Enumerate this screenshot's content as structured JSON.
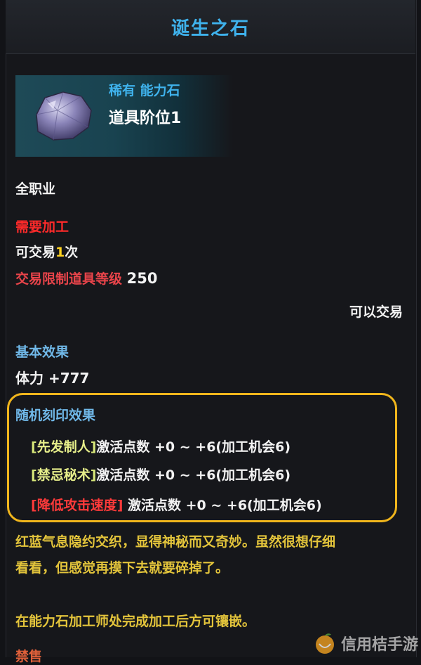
{
  "title": "诞生之石",
  "item": {
    "rarity": "稀有 能力石",
    "tier": "道具阶位1"
  },
  "job": "全职业",
  "requires_processing": "需要加工",
  "tradable": {
    "prefix": "可交易",
    "count": "1",
    "suffix": "次"
  },
  "trade_limit": {
    "label": "交易限制道具等级",
    "value": "250"
  },
  "can_trade": "可以交易",
  "basic_effect": {
    "header": "基本效果",
    "stat": "体力 +777"
  },
  "random_engrave": {
    "header": "随机刻印效果",
    "effects": [
      {
        "open": "[",
        "name": "先发制人",
        "close": "]",
        "text": "激活点数 +0 ~ +6(加工机会6)"
      },
      {
        "open": "[",
        "name": "禁忌秘术",
        "close": "]",
        "text": "激活点数 +0 ~ +6(加工机会6)"
      },
      {
        "open": "[",
        "name": "降低攻击速度",
        "close": "]",
        "text": " 激活点数 +0 ~ +6(加工机会6)"
      }
    ]
  },
  "description": {
    "line1": "红蓝气息隐约交织，显得神秘而又奇妙。虽然很想仔细",
    "line2": "看看，但感觉再摸下去就要碎掉了。",
    "line3": "在能力石加工师处完成加工后方可镶嵌。",
    "line4": "禁售"
  },
  "watermark": "信用桔手游",
  "colors": {
    "title": "#3fb2ec",
    "warning": "#ff2a2a",
    "highlight_border": "#f0b51c",
    "description": "#e3c43b"
  }
}
